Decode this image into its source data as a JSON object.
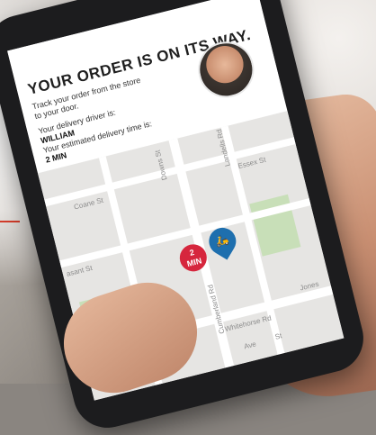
{
  "screen": {
    "title": "YOUR ORDER IS ON ITS WAY.",
    "track_line1": "Track your order from the store",
    "track_line2": "to your door.",
    "driver_label": "Your delivery driver is:",
    "driver_name": "WILLIAM",
    "eta_label": "Your estimated delivery time is:",
    "eta_value": "2 MIN"
  },
  "map": {
    "streets": [
      "Coane St",
      "Downs St",
      "Landells Rd",
      "Essex St",
      "asant St",
      "Cumberland Rd",
      "Whitehorse Rd",
      "Jones",
      "St",
      "Ave"
    ],
    "pin_red_line1": "2",
    "pin_red_line2": "MIN",
    "pin_blue_icon": "scooter-icon"
  },
  "colors": {
    "pin_red": "#d6263d",
    "pin_blue": "#1e6fae",
    "park": "#c8dfb8"
  }
}
